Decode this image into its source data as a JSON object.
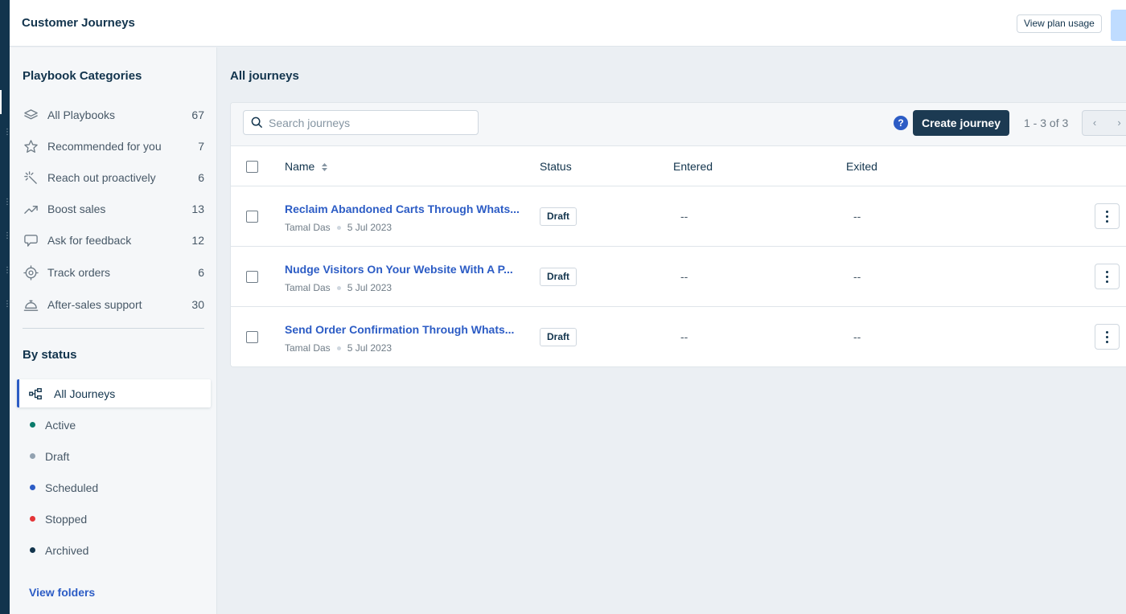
{
  "header": {
    "title": "Customer Journeys",
    "plan_button": "View plan usage"
  },
  "sidebar": {
    "categories_heading": "Playbook Categories",
    "categories": [
      {
        "label": "All Playbooks",
        "count": "67",
        "icon": "stack-icon"
      },
      {
        "label": "Recommended for you",
        "count": "7",
        "icon": "star-icon"
      },
      {
        "label": "Reach out proactively",
        "count": "6",
        "icon": "burst-icon"
      },
      {
        "label": "Boost sales",
        "count": "13",
        "icon": "trend-up-icon"
      },
      {
        "label": "Ask for feedback",
        "count": "12",
        "icon": "chat-bubble-icon"
      },
      {
        "label": "Track orders",
        "count": "6",
        "icon": "target-icon"
      },
      {
        "label": "After-sales support",
        "count": "30",
        "icon": "service-bell-icon"
      }
    ],
    "status_heading": "By status",
    "statuses": [
      {
        "label": "All Journeys",
        "color": ""
      },
      {
        "label": "Active",
        "color": "#0a7b6b"
      },
      {
        "label": "Draft",
        "color": "#92a2b1"
      },
      {
        "label": "Scheduled",
        "color": "#2c5cc5"
      },
      {
        "label": "Stopped",
        "color": "#e43538"
      },
      {
        "label": "Archived",
        "color": "#12344d"
      }
    ],
    "view_folders": "View folders"
  },
  "main": {
    "title": "All journeys",
    "search_placeholder": "Search journeys",
    "help": "?",
    "create_button": "Create journey",
    "pagination": "1 - 3 of 3",
    "prev": "‹",
    "next": "›",
    "columns": {
      "name": "Name",
      "status": "Status",
      "entered": "Entered",
      "exited": "Exited"
    },
    "rows": [
      {
        "name": "Reclaim Abandoned Carts Through Whats...",
        "owner": "Tamal Das",
        "date": "5 Jul 2023",
        "status": "Draft",
        "entered": "--",
        "exited": "--"
      },
      {
        "name": "Nudge Visitors On Your Website With A P...",
        "owner": "Tamal Das",
        "date": "5 Jul 2023",
        "status": "Draft",
        "entered": "--",
        "exited": "--"
      },
      {
        "name": "Send Order Confirmation Through Whats...",
        "owner": "Tamal Das",
        "date": "5 Jul 2023",
        "status": "Draft",
        "entered": "--",
        "exited": "--"
      }
    ]
  }
}
